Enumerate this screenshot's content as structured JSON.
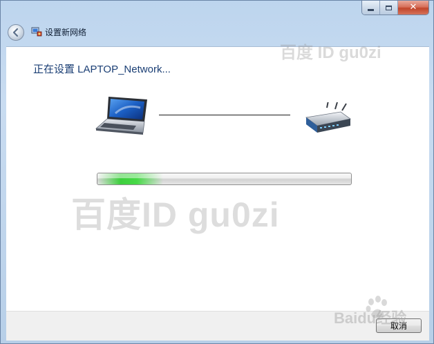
{
  "window": {
    "title": "设置新网络",
    "caption": {
      "minimize": "minimize",
      "maximize": "maximize",
      "close": "✕"
    }
  },
  "main": {
    "heading": "正在设置 LAPTOP_Network...",
    "devices": {
      "left": "laptop-icon",
      "right": "router-icon"
    },
    "progress": {
      "fraction": 0.26,
      "color": "#3ecf3e"
    }
  },
  "footer": {
    "cancel_label": "取消"
  },
  "watermarks": {
    "top": "百度 ID gu0zi",
    "center": "百度ID gu0zi",
    "corner": "Baidu经验"
  }
}
